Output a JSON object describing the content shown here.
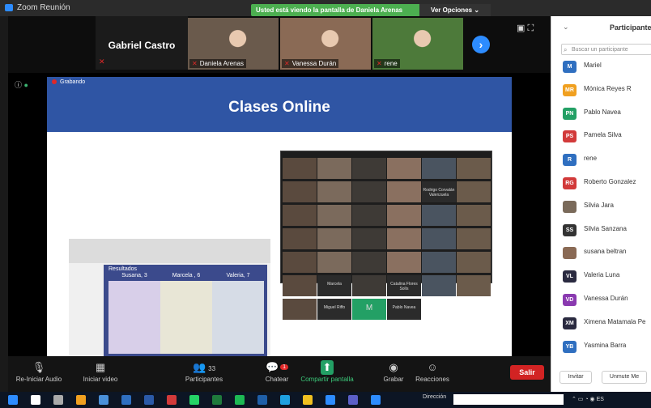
{
  "window": {
    "title": "Zoom Reunión"
  },
  "share_banner": {
    "text": "Usted está viendo la pantalla de Daniela Arenas",
    "options_label": "Ver Opciones"
  },
  "thumbnails": {
    "name_card": "Gabriel Castro",
    "videos": [
      {
        "name": "Daniela Arenas",
        "color": "#6a5a4c"
      },
      {
        "name": "Vanessa Durán",
        "color": "#8a6a55"
      },
      {
        "name": "rene",
        "color": "#4d7a3a"
      }
    ]
  },
  "shared_screen": {
    "recording_label": "Grabando",
    "title": "Clases Online",
    "tray_caption": "Resultados",
    "trays": [
      {
        "label": "Susana, 3",
        "color": "#d8cfe9"
      },
      {
        "label": "Marcela , 6",
        "color": "#e8e6d6"
      },
      {
        "label": "Valeria, 7",
        "color": "#d6dce6"
      }
    ],
    "grid_tiles": [
      "",
      "",
      "",
      "",
      "",
      "",
      "",
      "",
      "",
      "",
      "Rodrigo Corvalán Valenzuela",
      "",
      "",
      "",
      "",
      "",
      "",
      "",
      "",
      "",
      "",
      "",
      "",
      "",
      "",
      "",
      "",
      "",
      "",
      "",
      "",
      "Marcela",
      "",
      "Catalina Flores Solís",
      "",
      "",
      "",
      "Miguel Riffo",
      "M",
      "Pablo Navea"
    ]
  },
  "toolbar": {
    "items": [
      {
        "label": "Re-Iniciar Audio",
        "icon": "mic-muted-icon"
      },
      {
        "label": "Iniciar video",
        "icon": "video-off-icon"
      },
      {
        "label": "Participantes",
        "icon": "participants-icon",
        "count": "33"
      },
      {
        "label": "Chatear",
        "icon": "chat-icon",
        "badge": "1"
      },
      {
        "label": "Compartir pantalla",
        "icon": "share-screen-icon"
      },
      {
        "label": "Grabar",
        "icon": "record-icon"
      },
      {
        "label": "Reacciones",
        "icon": "reactions-icon"
      }
    ],
    "leave_label": "Salir"
  },
  "participants": {
    "title": "Participantes",
    "search_placeholder": "Buscar un participante",
    "list": [
      {
        "initials": "M",
        "name": "Mariel",
        "color": "#2f6fc0"
      },
      {
        "initials": "MR",
        "name": "Mónica Reyes R",
        "color": "#f0a020"
      },
      {
        "initials": "PN",
        "name": "Pablo Navea",
        "color": "#23a065"
      },
      {
        "initials": "PS",
        "name": "Pamela Silva",
        "color": "#d23a3a"
      },
      {
        "initials": "R",
        "name": "rene",
        "color": "#2f6fc0"
      },
      {
        "initials": "RG",
        "name": "Roberto Gonzalez",
        "color": "#d23a3a"
      },
      {
        "initials": "",
        "name": "Silvia Jara",
        "color": "#7a6a5a"
      },
      {
        "initials": "SS",
        "name": "Silvia Sanzana",
        "color": "#333333"
      },
      {
        "initials": "",
        "name": "susana beltran",
        "color": "#8a6a55"
      },
      {
        "initials": "VL",
        "name": "Valeria Luna",
        "color": "#2a2a40"
      },
      {
        "initials": "VD",
        "name": "Vanessa Durán",
        "color": "#8a3ab0"
      },
      {
        "initials": "XM",
        "name": "Ximena Matamala Pe",
        "color": "#2a2a40"
      },
      {
        "initials": "YB",
        "name": "Yasmina Barra",
        "color": "#2f6fc0"
      }
    ],
    "invite_label": "Invitar",
    "unmute_label": "Unmute Me"
  },
  "taskbar": {
    "address_label": "Dirección",
    "lang": "ES"
  }
}
